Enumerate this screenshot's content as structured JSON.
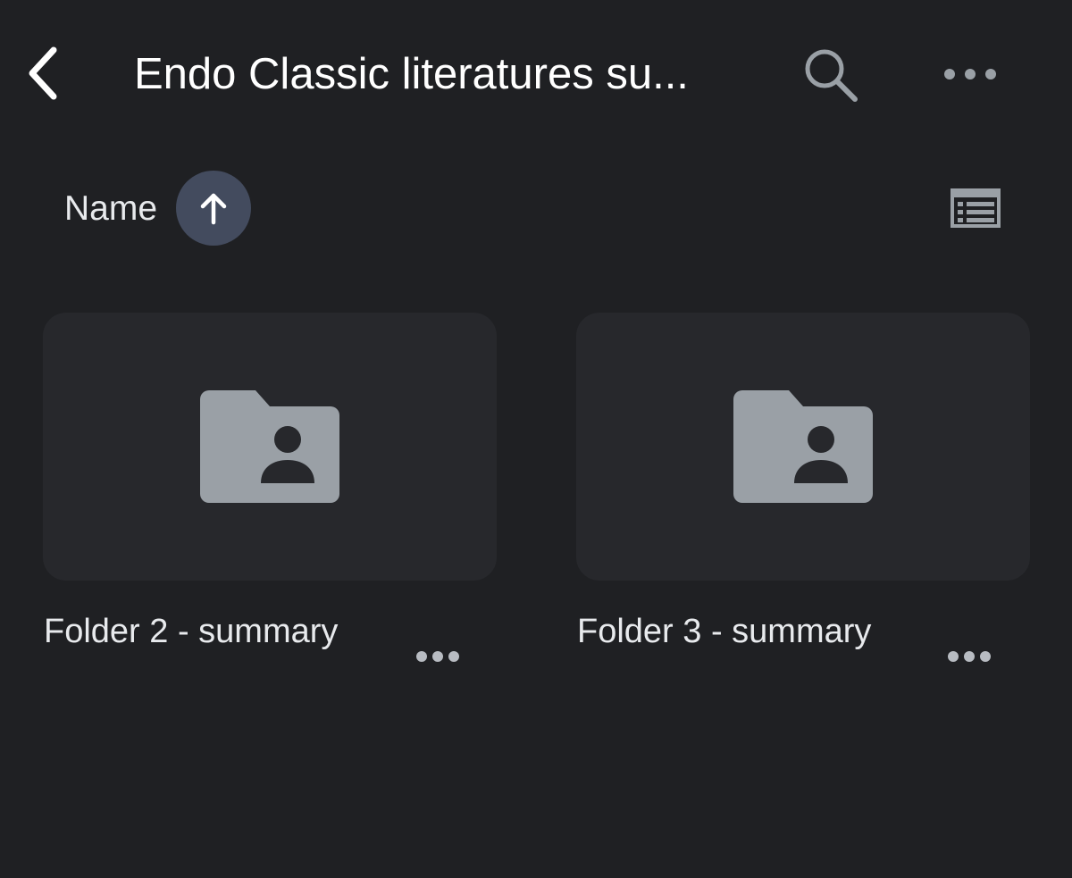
{
  "header": {
    "back_icon": "chevron-left-icon",
    "title": "Endo Classic literatures su...",
    "search_icon": "search-icon",
    "more_icon": "more-horizontal-icon"
  },
  "sort": {
    "label": "Name",
    "direction_icon": "arrow-up-icon",
    "view_icon": "list-view-icon"
  },
  "folders": [
    {
      "name": "Folder 2 - summary",
      "icon": "shared-folder-icon",
      "more_icon": "more-horizontal-icon"
    },
    {
      "name": "Folder 3 - summary",
      "icon": "shared-folder-icon",
      "more_icon": "more-horizontal-icon"
    }
  ],
  "colors": {
    "background": "#1f2023",
    "card": "#27282c",
    "sort_button": "#434b5e",
    "icon_gray": "#9aa0a6",
    "text": "#e8eaed"
  }
}
